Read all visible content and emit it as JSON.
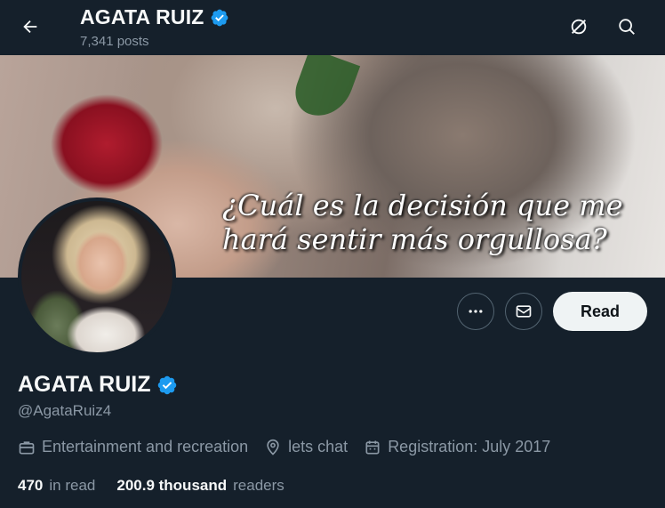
{
  "header": {
    "title": "AGATA RUIZ",
    "posts": "7,341 posts",
    "back_icon": "arrow-left-icon",
    "grok_icon": "grok-icon",
    "search_icon": "search-icon"
  },
  "banner": {
    "overlay_text_line1": "¿Cuál es la decisión que me",
    "overlay_text_line2": "hará sentir más orgullosa?"
  },
  "profile": {
    "name": "AGATA RUIZ",
    "handle": "@AgataRuiz4",
    "verified_color": "#1d9bf0",
    "category": "Entertainment and recreation",
    "location": "lets chat",
    "joined": "Registration: July 2017"
  },
  "actions": {
    "more_icon": "more-dots-icon",
    "message_icon": "envelope-icon",
    "follow_label": "Read"
  },
  "stats": {
    "following_count": "470",
    "following_label": "in read",
    "followers_count": "200.9 thousand",
    "followers_label": "readers"
  },
  "colors": {
    "background": "#15202b",
    "muted_text": "#8b98a5",
    "border": "#536471"
  }
}
